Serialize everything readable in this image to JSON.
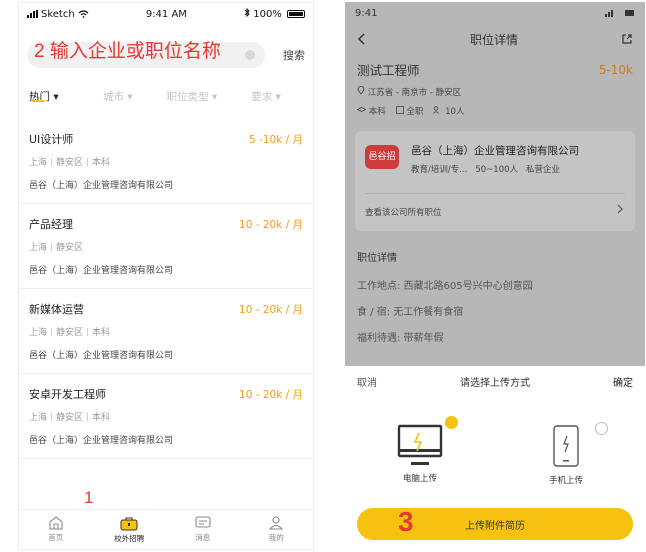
{
  "left": {
    "status": {
      "carrier": "Sketch",
      "time": "9:41 AM",
      "battery": "100%"
    },
    "search": {
      "placeholder": "2 输入企业或职位名称",
      "button": "搜索"
    },
    "filters": [
      "热门 ▾",
      "城市 ▾",
      "职位类型 ▾",
      "要求 ▾"
    ],
    "jobs": [
      {
        "title": "UI设计师",
        "salary": "5 -10k / 月",
        "city": "上海",
        "district": "静安区",
        "degree": "本科",
        "company": "邑谷（上海）企业管理咨询有限公司"
      },
      {
        "title": "产品经理",
        "salary": "10 - 20k / 月",
        "city": "上海",
        "district": "静安区",
        "degree": "本科",
        "company": "邑谷（上海）企业管理咨询有限公司"
      },
      {
        "title": "新媒体运营",
        "salary": "10 - 20k / 月",
        "city": "上海",
        "district": "静安区",
        "degree": "本科",
        "company": "邑谷（上海）企业管理咨询有限公司"
      },
      {
        "title": "安卓开发工程师",
        "salary": "10 - 20k / 月",
        "city": "上海",
        "district": "静安区",
        "degree": "本科",
        "company": "邑谷（上海）企业管理咨询有限公司"
      }
    ],
    "tabs": [
      {
        "label": "首页",
        "icon": "home-icon"
      },
      {
        "label": "校外招聘",
        "icon": "briefcase-icon"
      },
      {
        "label": "消息",
        "icon": "message-icon"
      },
      {
        "label": "我的",
        "icon": "user-icon"
      }
    ],
    "annotation_1": "1"
  },
  "right": {
    "status": {
      "time": "9:41"
    },
    "nav": {
      "title": "职位详情"
    },
    "job": {
      "title": "测试工程师",
      "salary": "5-10k",
      "location": "江苏省 - 南京市 - 静安区",
      "degree": "本科",
      "type": "全职",
      "headcount": "10人"
    },
    "company": {
      "logo_text": "邑谷招",
      "name": "邑谷（上海）企业管理咨询有限公司",
      "industry": "教育/培训/专...",
      "size": "50~100人",
      "ownership": "私营企业",
      "all_jobs": "查看该公司所有职位"
    },
    "detail": {
      "section": "职位详情",
      "address": "工作地点:   西藏北路605号兴中心创意园",
      "food": "食   /   宿:  无工作餐有食宿",
      "welfare": "福利待遇:   带薪年假"
    },
    "sheet": {
      "cancel": "取消",
      "title": "请选择上传方式",
      "confirm": "确定",
      "desktop": "电脑上传",
      "mobile": "手机上传",
      "upload_button": "上传附件简历"
    },
    "annotation_3": "3"
  },
  "colors": {
    "accent": "#f5c211",
    "salary": "#f39c12",
    "annotation": "#e53935"
  }
}
